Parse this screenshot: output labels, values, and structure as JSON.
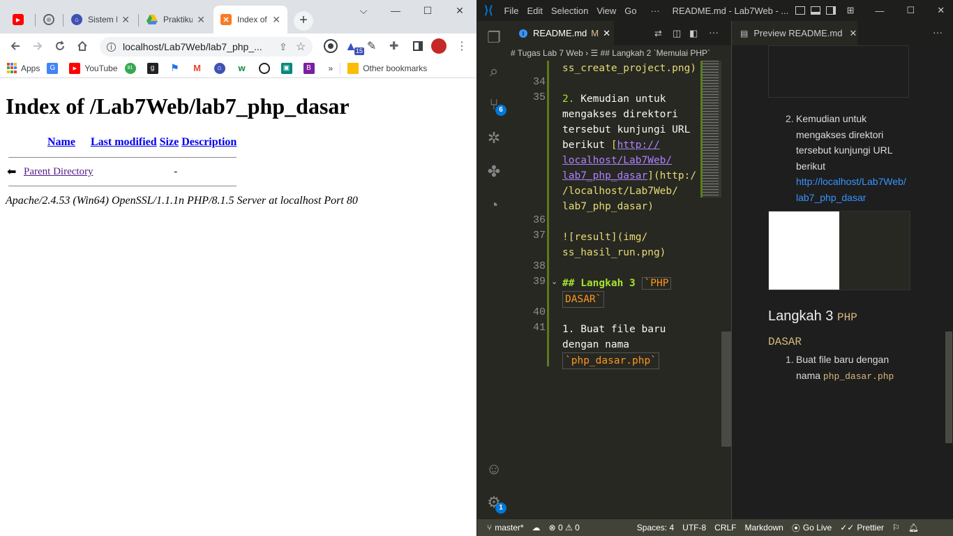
{
  "chrome": {
    "tabs": [
      {
        "title": "",
        "icon": "youtube-icon"
      },
      {
        "title": "",
        "icon": "globe-icon"
      },
      {
        "title": "Sistem In",
        "icon": "university-icon"
      },
      {
        "title": "Praktiku",
        "icon": "drive-icon"
      },
      {
        "title": "Index of",
        "icon": "xampp-icon",
        "active": true
      }
    ],
    "new_tab": "+",
    "window_controls": [
      "⌵",
      "—",
      "☐",
      "✕"
    ],
    "url": "localhost/Lab7Web/lab7_php_...",
    "extension_badge": "15",
    "bookmarks": [
      {
        "label": "Apps",
        "icon": "apps-icon",
        "color": "#ea4335"
      },
      {
        "label": "",
        "icon": "translate-icon",
        "color": "#4285f4"
      },
      {
        "label": "YouTube",
        "icon": "youtube-icon",
        "color": "#ff0000"
      },
      {
        "label": "",
        "icon": "badge-81-icon",
        "color": "#34a853"
      },
      {
        "label": "",
        "icon": "g-icon",
        "color": "#202124"
      },
      {
        "label": "",
        "icon": "flag-icon",
        "color": "#1a73e8"
      },
      {
        "label": "",
        "icon": "gmail-icon",
        "color": "#ea4335"
      },
      {
        "label": "",
        "icon": "university-icon",
        "color": "#3c4043"
      },
      {
        "label": "",
        "icon": "w-icon",
        "color": "#0a8a3a"
      },
      {
        "label": "",
        "icon": "github-icon",
        "color": "#202124"
      },
      {
        "label": "",
        "icon": "meet-icon",
        "color": "#00897b"
      },
      {
        "label": "",
        "icon": "b-icon",
        "color": "#7b1fa2"
      }
    ],
    "bookmarks_more": "»",
    "other_bookmarks": "Other bookmarks",
    "page": {
      "title": "Index of /Lab7Web/lab7_php_dasar",
      "columns": [
        "Name",
        "Last modified",
        "Size",
        "Description"
      ],
      "rows": [
        {
          "name": "Parent Directory",
          "modified": "",
          "size": "-",
          "description": ""
        }
      ],
      "footer": "Apache/2.4.53 (Win64) OpenSSL/1.1.1n PHP/8.1.5 Server at localhost Port 80"
    }
  },
  "vscode": {
    "menu": [
      "File",
      "Edit",
      "Selection",
      "View",
      "Go",
      "···"
    ],
    "title": "README.md - Lab7Web - ...",
    "editor_tab": "README.md",
    "editor_tab_modified": "M",
    "breadcrumb": "# Tugas Lab 7 Web  ›  ☰ ## Langkah 2 `Memulai PHP`",
    "activity_badges": {
      "scm": "6",
      "settings": "1"
    },
    "line_numbers": [
      "34",
      "35",
      "36",
      "37",
      "38",
      "39",
      "40",
      "41"
    ],
    "code": {
      "l33_tail": "ss_create_project.png)",
      "l35": [
        "2. Kemudian untuk",
        "mengakses direktori",
        "tersebut kunjungi URL",
        "berikut [http://",
        "localhost/Lab7Web/",
        "lab7_php_dasar](http:/",
        "/localhost/Lab7Web/",
        "lab7_php_dasar)"
      ],
      "l37": [
        "![result](img/",
        "ss_hasil_run.png)"
      ],
      "l39": [
        "## Langkah 3 `PHP",
        "DASAR`"
      ],
      "l41": [
        "1. Buat file baru",
        "dengan nama",
        "`php_dasar.php`"
      ]
    },
    "preview_tab": "Preview README.md",
    "preview": {
      "item2_num": "2.",
      "item2_text": [
        "Kemudian untuk",
        "mengakses direktori",
        "tersebut kunjungi URL",
        "berikut"
      ],
      "item2_link": [
        "http://localhost/Lab7Web/",
        "lab7_php_dasar"
      ],
      "heading_plain": "Langkah 3",
      "heading_code1": "PHP",
      "heading_code2": "DASAR",
      "item1_num": "1.",
      "item1_text": [
        "Buat file baru dengan",
        "nama"
      ],
      "item1_code": "php_dasar.php"
    },
    "status": {
      "branch": "master*",
      "errors": "0",
      "warnings": "0",
      "spaces": "Spaces: 4",
      "encoding": "UTF-8",
      "eol": "CRLF",
      "language": "Markdown",
      "golive": "Go Live",
      "prettier": "Prettier"
    },
    "colors": {
      "accent": "#0078d4",
      "string": "#e6db74",
      "link": "#ae81ff",
      "heading": "#a6e22e"
    }
  }
}
